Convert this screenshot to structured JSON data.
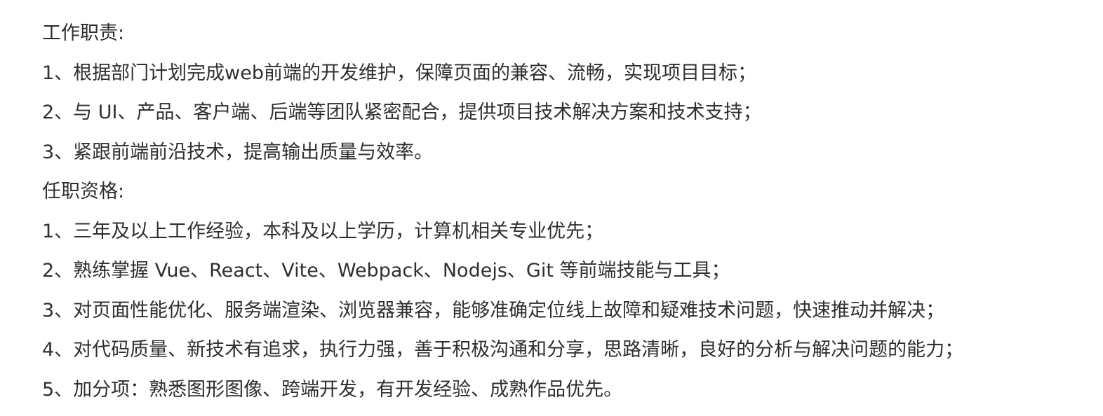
{
  "responsibilities": {
    "heading": "工作职责:",
    "items": [
      "1、根据部门计划完成web前端的开发维护，保障页面的兼容、流畅，实现项目目标；",
      "2、与 UI、产品、客户端、后端等团队紧密配合，提供项目技术解决方案和技术支持；",
      "3、紧跟前端前沿技术，提高输出质量与效率。"
    ]
  },
  "qualifications": {
    "heading": "任职资格:",
    "items": [
      "1、三年及以上工作经验，本科及以上学历，计算机相关专业优先；",
      "2、熟练掌握 Vue、React、Vite、Webpack、Nodejs、Git 等前端技能与工具；",
      "3、对页面性能优化、服务端渲染、浏览器兼容，能够准确定位线上故障和疑难技术问题，快速推动并解决；",
      "4、对代码质量、新技术有追求，执行力强，善于积极沟通和分享，思路清晰，良好的分析与解决问题的能力；",
      "5、加分项：熟悉图形图像、跨端开发，有开发经验、成熟作品优先。"
    ]
  }
}
